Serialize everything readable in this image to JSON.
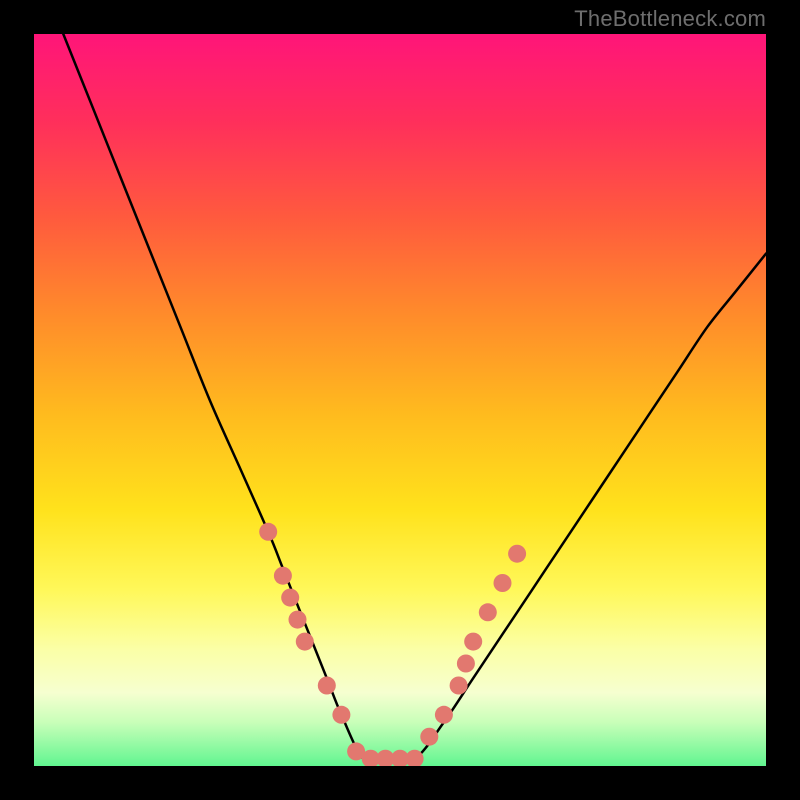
{
  "watermark": "TheBottleneck.com",
  "chart_data": {
    "type": "line",
    "title": "",
    "xlabel": "",
    "ylabel": "",
    "xlim": [
      0,
      100
    ],
    "ylim": [
      0,
      100
    ],
    "grid": false,
    "legend": false,
    "series": [
      {
        "name": "curve",
        "x": [
          4,
          8,
          12,
          16,
          20,
          24,
          28,
          32,
          34,
          36,
          38,
          40,
          42,
          45,
          48,
          52,
          56,
          60,
          64,
          68,
          72,
          76,
          80,
          84,
          88,
          92,
          96,
          100
        ],
        "y": [
          100,
          90,
          80,
          70,
          60,
          50,
          41,
          32,
          27,
          22,
          17,
          12,
          7,
          1,
          1,
          1,
          6,
          12,
          18,
          24,
          30,
          36,
          42,
          48,
          54,
          60,
          65,
          70
        ]
      }
    ],
    "markers": {
      "name": "highlight-points",
      "color": "#e2786f",
      "radius_est_px": 9,
      "points": [
        {
          "x": 32,
          "y": 32
        },
        {
          "x": 34,
          "y": 26
        },
        {
          "x": 35,
          "y": 23
        },
        {
          "x": 36,
          "y": 20
        },
        {
          "x": 37,
          "y": 17
        },
        {
          "x": 40,
          "y": 11
        },
        {
          "x": 42,
          "y": 7
        },
        {
          "x": 44,
          "y": 2
        },
        {
          "x": 46,
          "y": 1
        },
        {
          "x": 48,
          "y": 1
        },
        {
          "x": 50,
          "y": 1
        },
        {
          "x": 52,
          "y": 1
        },
        {
          "x": 54,
          "y": 4
        },
        {
          "x": 56,
          "y": 7
        },
        {
          "x": 58,
          "y": 11
        },
        {
          "x": 59,
          "y": 14
        },
        {
          "x": 60,
          "y": 17
        },
        {
          "x": 62,
          "y": 21
        },
        {
          "x": 64,
          "y": 25
        },
        {
          "x": 66,
          "y": 29
        }
      ]
    }
  }
}
